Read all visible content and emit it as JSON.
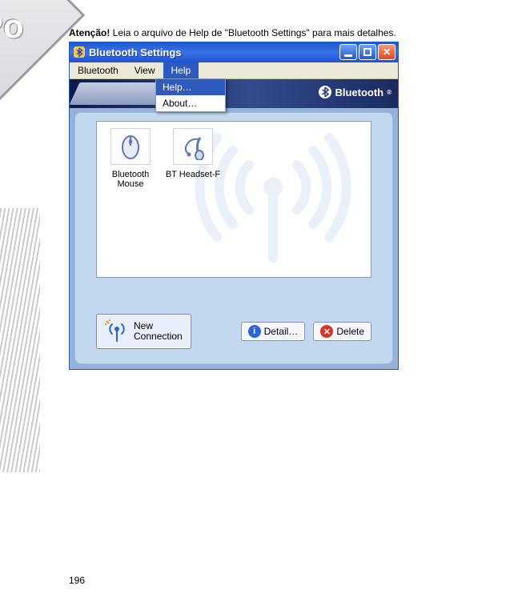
{
  "page": {
    "caption_strong": "Atenção!",
    "caption_rest": " Leia o arquivo de Help de   \"Bluetooth Settings\" para mais detalhes.",
    "page_number": "196"
  },
  "decor": {
    "logo_text": "Po"
  },
  "window": {
    "title": "Bluetooth Settings",
    "menu": {
      "bluetooth": "Bluetooth",
      "view": "View",
      "help": "Help"
    },
    "help_dropdown": {
      "help": "Help…",
      "about": "About…"
    },
    "banner": {
      "brand": "Bluetooth"
    },
    "devices": [
      {
        "label": "Bluetooth Mouse",
        "icon": "mouse-icon"
      },
      {
        "label": "BT Headset-F",
        "icon": "headset-icon"
      }
    ],
    "buttons": {
      "new_connection_line1": "New",
      "new_connection_line2": "Connection",
      "detail": "Detail…",
      "delete": "Delete"
    }
  }
}
